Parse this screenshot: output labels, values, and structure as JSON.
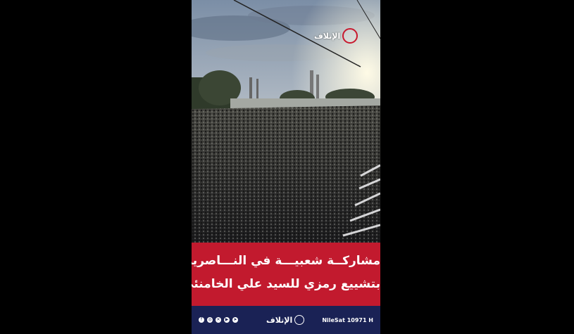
{
  "video": {
    "channel_logo_text": "الإتلاف",
    "caption_line1": "مشاركــة شعبيـــة في النـــاصرية",
    "caption_line2": "بتشييع رمزي للسيد علي الخامنئي",
    "colors": {
      "caption_bg": "#c21a2e",
      "footer_bg": "#1a2255"
    }
  },
  "footer": {
    "social_icons": [
      "facebook-icon",
      "instagram-icon",
      "x-icon",
      "youtube-icon",
      "telegram-icon"
    ],
    "social_glyphs": [
      "f",
      "◎",
      "✕",
      "▶",
      "➤"
    ],
    "logo_text": "الإتلاف",
    "frequency": "NileSat 10971 H"
  }
}
